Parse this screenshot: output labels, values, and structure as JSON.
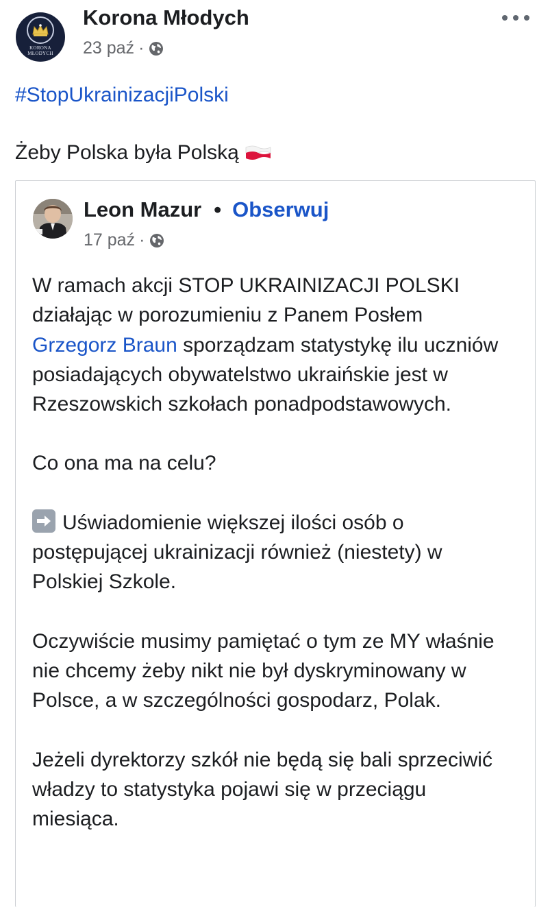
{
  "post": {
    "page_name": "Korona Młodych",
    "date": "23 paź",
    "separator": "·",
    "avatar_text_line1": "KORONA",
    "avatar_text_line2": "MŁODYCH",
    "hashtag": "#StopUkrainizacjiPolski",
    "intro": "Żeby Polska była Polską",
    "flag_emoji": "polish-flag",
    "more_icon": "more-options-icon",
    "privacy_icon": "globe-icon"
  },
  "shared": {
    "author": "Leon Mazur",
    "dot": "•",
    "follow_label": "Obserwuj",
    "date": "17 paź",
    "separator": "·",
    "p1_before": "W ramach akcji STOP UKRAINIZACJI POLSKI działając w porozumieniu z Panem Posłem ",
    "p1_mention": "Grzegorz Braun",
    "p1_after": " sporządzam statystykę ilu uczniów posiadających obywatelstwo ukraińskie jest w Rzeszowskich szkołach ponadpodstawowych.",
    "p2": "Co ona ma na celu?",
    "p3_emoji": "right-arrow-emoji",
    "p3": "Uświadomienie większej ilości osób o postępującej ukrainizacji również (niestety) w Polskiej Szkole.",
    "p4": "Oczywiście musimy pamiętać o tym ze MY właśnie nie chcemy żeby nikt nie był dyskryminowany w Polsce, a w szczególności gospodarz, Polak.",
    "p5": "Jeżeli dyrektorzy szkół nie będą się bali sprzeciwić władzy to statystyka pojawi się w przeciągu miesiąca."
  },
  "colors": {
    "link_blue": "#1a55c8",
    "text": "#1c1e21",
    "meta_gray": "#65676b",
    "avatar_navy": "#17203a"
  }
}
